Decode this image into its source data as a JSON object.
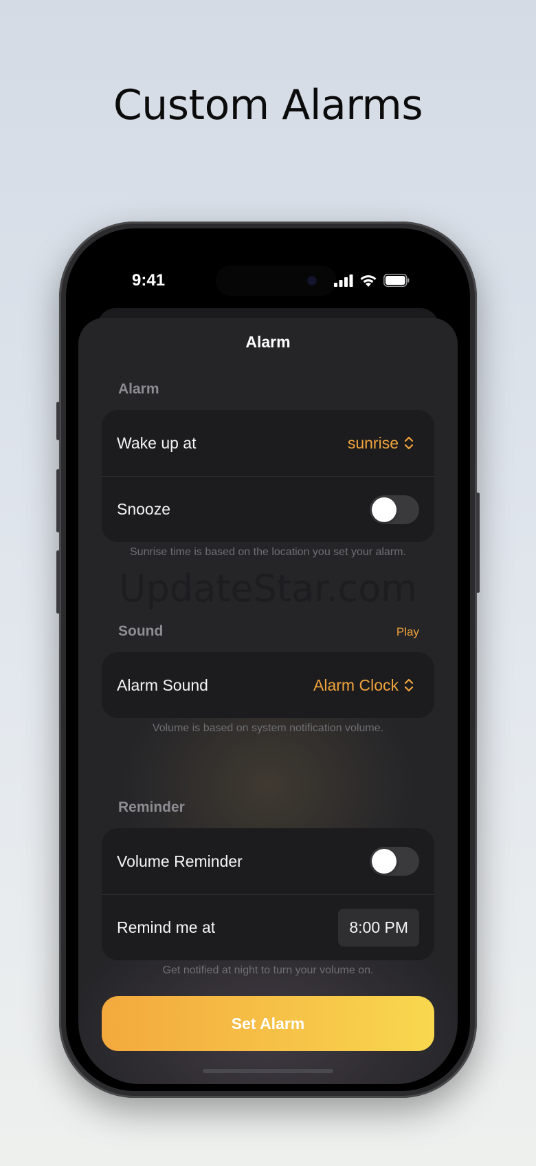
{
  "headline": "Custom Alarms",
  "status_bar": {
    "time": "9:41"
  },
  "sheet": {
    "title": "Alarm",
    "alarm_section": {
      "header": "Alarm",
      "wake_up": {
        "label": "Wake up at",
        "value": "sunrise"
      },
      "snooze": {
        "label": "Snooze",
        "enabled": false
      },
      "footnote": "Sunrise time is based on the location you set your alarm."
    },
    "watermark": "UpdateStar.com",
    "sound_section": {
      "header": "Sound",
      "action": "Play",
      "alarm_sound": {
        "label": "Alarm Sound",
        "value": "Alarm Clock"
      },
      "footnote": "Volume is based on system notification volume."
    },
    "reminder_section": {
      "header": "Reminder",
      "volume_reminder": {
        "label": "Volume Reminder",
        "enabled": false
      },
      "remind_at": {
        "label": "Remind me at",
        "value": "8:00 PM"
      },
      "footnote": "Get notified at night to turn your volume on."
    },
    "cta": "Set Alarm"
  },
  "colors": {
    "accent": "#f2a43c",
    "sheet_bg": "#252528",
    "card_bg": "#1c1c1e"
  }
}
